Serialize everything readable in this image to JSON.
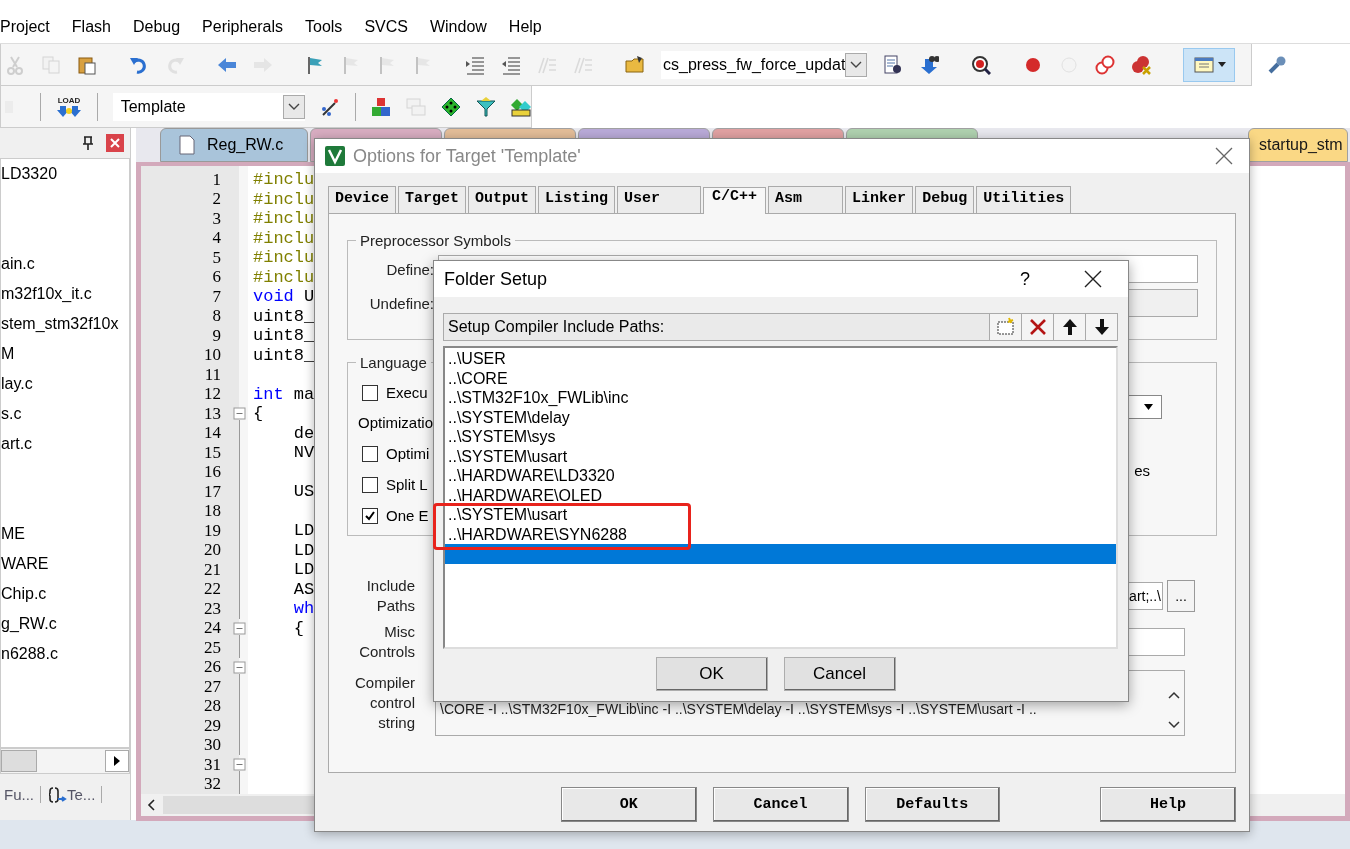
{
  "menu": [
    "Project",
    "Flash",
    "Debug",
    "Peripherals",
    "Tools",
    "SVCS",
    "Window",
    "Help"
  ],
  "toolbar1": [
    {
      "items": [
        {
          "kind": "cut",
          "disabled": true,
          "active": false
        },
        {
          "kind": "copy",
          "disabled": true,
          "active": false
        },
        {
          "kind": "paste",
          "disabled": false,
          "active": false
        }
      ]
    },
    {
      "items": [
        {
          "kind": "undo",
          "disabled": false,
          "active": false
        },
        {
          "kind": "redo",
          "disabled": true,
          "active": false
        }
      ]
    },
    {
      "items": [
        {
          "kind": "back",
          "disabled": false,
          "active": false
        },
        {
          "kind": "forward",
          "disabled": true,
          "active": false
        }
      ]
    },
    {
      "items": [
        {
          "kind": "flag",
          "disabled": false,
          "active": false
        },
        {
          "kind": "flag",
          "disabled": true,
          "active": false
        },
        {
          "kind": "flag",
          "disabled": true,
          "active": false
        },
        {
          "kind": "flag",
          "disabled": true,
          "active": false
        }
      ]
    },
    {
      "items": [
        {
          "kind": "indent",
          "disabled": false,
          "active": false
        },
        {
          "kind": "outdent",
          "disabled": false,
          "active": false
        },
        {
          "kind": "comment",
          "disabled": true,
          "active": false
        },
        {
          "kind": "comment",
          "disabled": true,
          "active": false
        }
      ]
    },
    {
      "items": [
        {
          "kind": "folder",
          "disabled": false,
          "active": false
        },
        {
          "kind": "combo",
          "value": "cs_press_fw_force_updat"
        },
        {
          "kind": "find",
          "disabled": false,
          "active": false
        },
        {
          "kind": "binoculars",
          "disabled": false,
          "active": false
        }
      ]
    },
    {
      "items": [
        {
          "kind": "debug",
          "disabled": false,
          "active": false
        }
      ]
    },
    {
      "items": [
        {
          "kind": "breakpoint",
          "disabled": false,
          "active": false
        },
        {
          "kind": "circle",
          "disabled": true,
          "active": false
        },
        {
          "kind": "circles",
          "disabled": false,
          "active": false
        },
        {
          "kind": "kill",
          "disabled": false,
          "active": false
        }
      ]
    },
    {
      "items": [
        {
          "kind": "window",
          "disabled": false,
          "active": true
        }
      ]
    },
    {
      "items": [
        {
          "kind": "wrench",
          "disabled": false,
          "active": false
        }
      ]
    }
  ],
  "toolbar2": [
    {
      "items": [
        {
          "kind": "partial",
          "disabled": true,
          "active": false
        }
      ]
    },
    {
      "items": [
        {
          "kind": "load",
          "label": "LOAD",
          "disabled": false,
          "active": false
        }
      ]
    },
    {
      "items": [
        {
          "kind": "combo",
          "value": "Template"
        },
        {
          "kind": "wand",
          "disabled": false,
          "active": false
        }
      ]
    },
    {
      "items": [
        {
          "kind": "blocks",
          "disabled": false,
          "active": false
        },
        {
          "kind": "windows",
          "disabled": true,
          "active": false
        },
        {
          "kind": "diamond",
          "disabled": false,
          "active": false
        },
        {
          "kind": "funnel",
          "disabled": false,
          "active": false
        },
        {
          "kind": "diamonds",
          "disabled": false,
          "active": false
        }
      ]
    }
  ],
  "project_panel": {
    "items": [
      {
        "kind": "file",
        "text": "LD3320"
      },
      {
        "kind": "spacer"
      },
      {
        "kind": "spacer"
      },
      {
        "kind": "file",
        "text": "ain.c"
      },
      {
        "kind": "file",
        "text": "m32f10x_it.c"
      },
      {
        "kind": "file",
        "text": "stem_stm32f10x"
      },
      {
        "kind": "file",
        "text": "M"
      },
      {
        "kind": "file",
        "text": "lay.c"
      },
      {
        "kind": "file",
        "text": "s.c"
      },
      {
        "kind": "file",
        "text": "art.c"
      },
      {
        "kind": "spacer"
      },
      {
        "kind": "spacer"
      },
      {
        "kind": "file",
        "text": "ME"
      },
      {
        "kind": "file",
        "text": "WARE"
      },
      {
        "kind": "file",
        "text": "Chip.c"
      },
      {
        "kind": "file",
        "text": "g_RW.c"
      },
      {
        "kind": "file",
        "text": "n6288.c"
      }
    ],
    "tabs": [
      {
        "label": "Fu..."
      },
      {
        "label": "Te..."
      }
    ]
  },
  "editor": {
    "tabs": [
      {
        "label": "Reg_RW.c",
        "selected": true,
        "color": "#a9c4da"
      },
      {
        "selected": false,
        "color": "#d7a7bd"
      },
      {
        "selected": false,
        "color": "#e3b98f"
      },
      {
        "selected": false,
        "color": "#b5a4d6"
      },
      {
        "selected": false,
        "color": "#e09a9a"
      },
      {
        "selected": false,
        "color": "#a9cfa9"
      },
      {
        "label": "startup_stm",
        "selected": false,
        "color": "#fcd77a"
      }
    ],
    "lines": [
      {
        "number": "1",
        "kind": "plain",
        "code": [
          {
            "kind": "pp",
            "text": "#inclu"
          }
        ]
      },
      {
        "number": "2",
        "kind": "plain",
        "code": [
          {
            "kind": "pp",
            "text": "#inclu"
          }
        ]
      },
      {
        "number": "3",
        "kind": "plain",
        "code": [
          {
            "kind": "pp",
            "text": "#inclu"
          }
        ]
      },
      {
        "number": "4",
        "kind": "plain",
        "code": [
          {
            "kind": "pp",
            "text": "#inclu"
          }
        ]
      },
      {
        "number": "5",
        "kind": "plain",
        "code": [
          {
            "kind": "pp",
            "text": "#inclu"
          }
        ]
      },
      {
        "number": "6",
        "kind": "plain",
        "code": [
          {
            "kind": "pp",
            "text": "#inclu"
          }
        ]
      },
      {
        "number": "7",
        "kind": "plain",
        "code": [
          {
            "kind": "kw",
            "text": "void"
          },
          {
            "kind": "plain",
            "text": " U"
          }
        ]
      },
      {
        "number": "8",
        "kind": "plain",
        "code": [
          {
            "kind": "plain",
            "text": "uint8_"
          }
        ]
      },
      {
        "number": "9",
        "kind": "plain",
        "code": [
          {
            "kind": "plain",
            "text": "uint8_"
          }
        ]
      },
      {
        "number": "10",
        "kind": "plain",
        "code": [
          {
            "kind": "plain",
            "text": "uint8_"
          }
        ]
      },
      {
        "number": "11",
        "kind": "plain"
      },
      {
        "number": "12",
        "kind": "plain",
        "code": [
          {
            "kind": "kw",
            "text": "int"
          },
          {
            "kind": "plain",
            "text": " ma"
          }
        ]
      },
      {
        "number": "13",
        "kind": "fold_start",
        "code": [
          {
            "kind": "plain",
            "text": "{"
          }
        ]
      },
      {
        "number": "14",
        "kind": "fold_body",
        "code": [
          {
            "kind": "plain",
            "text": "    de"
          }
        ]
      },
      {
        "number": "15",
        "kind": "fold_body",
        "code": [
          {
            "kind": "plain",
            "text": "    NV"
          }
        ]
      },
      {
        "number": "16",
        "kind": "fold_body"
      },
      {
        "number": "17",
        "kind": "fold_body",
        "code": [
          {
            "kind": "plain",
            "text": "    US"
          }
        ]
      },
      {
        "number": "18",
        "kind": "fold_body"
      },
      {
        "number": "19",
        "kind": "fold_body",
        "code": [
          {
            "kind": "plain",
            "text": "    LD"
          }
        ]
      },
      {
        "number": "20",
        "kind": "fold_body",
        "code": [
          {
            "kind": "plain",
            "text": "    LD"
          }
        ]
      },
      {
        "number": "21",
        "kind": "fold_body",
        "code": [
          {
            "kind": "plain",
            "text": "    LD"
          }
        ]
      },
      {
        "number": "22",
        "kind": "fold_body",
        "code": [
          {
            "kind": "plain",
            "text": "    AS"
          }
        ]
      },
      {
        "number": "23",
        "kind": "fold_body",
        "code": [
          {
            "kind": "kw",
            "text": "    wh"
          }
        ]
      },
      {
        "number": "24",
        "kind": "fold_start",
        "code": [
          {
            "kind": "plain",
            "text": "    {"
          }
        ]
      },
      {
        "number": "25",
        "kind": "fold_body"
      },
      {
        "number": "26",
        "kind": "fold_start"
      },
      {
        "number": "27",
        "kind": "fold_body"
      },
      {
        "number": "28",
        "kind": "fold_body"
      },
      {
        "number": "29",
        "kind": "fold_body"
      },
      {
        "number": "30",
        "kind": "fold_body"
      },
      {
        "number": "31",
        "kind": "fold_start"
      },
      {
        "number": "32",
        "kind": "fold_body"
      }
    ]
  },
  "options_dialog": {
    "title": "Options for Target 'Template'",
    "tabs": [
      {
        "label": "Device",
        "selected": false
      },
      {
        "label": "Target",
        "selected": false
      },
      {
        "label": "Output",
        "selected": false
      },
      {
        "label": "Listing",
        "selected": false
      },
      {
        "label": "User",
        "selected": false
      },
      {
        "label": "C/C++",
        "selected": true
      },
      {
        "label": "Asm",
        "selected": false
      },
      {
        "label": "Linker",
        "selected": false
      },
      {
        "label": "Debug",
        "selected": false
      },
      {
        "label": "Utilities",
        "selected": false
      }
    ],
    "preprocessor": {
      "title": "Preprocessor Symbols",
      "define_label": "Define:",
      "undefine_label": "Undefine:"
    },
    "language": {
      "title": "Language",
      "checkboxes": [
        {
          "label": "Execu",
          "checked": false
        }
      ],
      "optimization_label": "Optimizatio",
      "options": [
        {
          "label": "Optimi",
          "checked": false
        },
        {
          "label": "Split L",
          "checked": false
        },
        {
          "label": "One E",
          "checked": true
        }
      ],
      "right_label": "es"
    },
    "include_paths": {
      "label": "Include Paths",
      "value": "art;..\\",
      "browse": "..."
    },
    "misc_controls": {
      "label": "Misc Controls"
    },
    "compiler_string": {
      "label": "Compiler control string",
      "value": "\\CORE -I ..\\STM32F10x_FWLib\\inc -I ..\\SYSTEM\\delay -I ..\\SYSTEM\\sys -I ..\\SYSTEM\\usart -I .."
    },
    "buttons": [
      "OK",
      "Cancel",
      "Defaults",
      "Help"
    ]
  },
  "folder_dialog": {
    "title": "Folder Setup",
    "help": "?",
    "header": "Setup Compiler Include Paths:",
    "paths": [
      {
        "text": "..\\USER",
        "selected": false,
        "highlighted": false
      },
      {
        "text": "..\\CORE",
        "selected": false,
        "highlighted": false
      },
      {
        "text": "..\\STM32F10x_FWLib\\inc",
        "selected": false,
        "highlighted": false
      },
      {
        "text": "..\\SYSTEM\\delay",
        "selected": false,
        "highlighted": false
      },
      {
        "text": "..\\SYSTEM\\sys",
        "selected": false,
        "highlighted": false
      },
      {
        "text": "..\\SYSTEM\\usart",
        "selected": false,
        "highlighted": false
      },
      {
        "text": "..\\HARDWARE\\LD3320",
        "selected": false,
        "highlighted": false
      },
      {
        "text": "..\\HARDWARE\\OLED",
        "selected": false,
        "highlighted": false
      },
      {
        "text": "..\\SYSTEM\\usart",
        "selected": false,
        "highlighted": true
      },
      {
        "text": "..\\HARDWARE\\SYN6288",
        "selected": false,
        "highlighted": true
      }
    ],
    "new_row": {
      "selected": true
    },
    "buttons": [
      "OK",
      "Cancel"
    ]
  }
}
